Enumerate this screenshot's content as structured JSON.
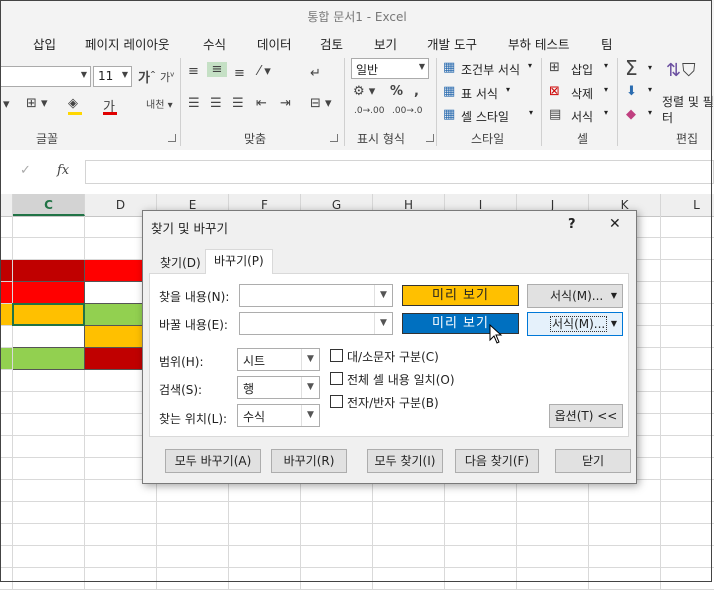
{
  "window": {
    "title": "통합 문서1 - Excel"
  },
  "menu_tabs": [
    "삽입",
    "페이지 레이아웃",
    "수식",
    "데이터",
    "검토",
    "보기",
    "개발 도구",
    "부하 테스트",
    "팀"
  ],
  "ribbon": {
    "font_size": "11",
    "number_format": "일반",
    "conditional_format": "조건부 서식",
    "format_as_table": "표 서식",
    "cell_styles": "셀 스타일",
    "insert": "삽입",
    "delete": "삭제",
    "format": "서식",
    "sort_filter": "정렬 및 필터",
    "groups": {
      "font": "글꼴",
      "alignment": "맞춤",
      "number": "표시 형식",
      "styles": "스타일",
      "cells": "셀",
      "editing": "편집"
    }
  },
  "formula_bar": {
    "fx": "fx",
    "value": ""
  },
  "columns": [
    "C",
    "D",
    "E",
    "F",
    "G",
    "H",
    "I",
    "J",
    "K",
    "L"
  ],
  "selected_column": "C",
  "cell_colors": {
    "dark_red": "#c00000",
    "red": "#ff0000",
    "yellow": "#ffc000",
    "green": "#92d050",
    "white": "#ffffff"
  },
  "dialog": {
    "title": "찾기 및 바꾸기",
    "help": "?",
    "close": "✕",
    "tab_find": "찾기(D)",
    "tab_replace": "바꾸기(P)",
    "find_label": "찾을 내용(N):",
    "replace_label": "바꿀 내용(E):",
    "find_value": "",
    "replace_value": "",
    "preview_find": "미리 보기",
    "preview_replace": "미리 보기",
    "preview_find_color": "#ffc000",
    "preview_replace_color": "#0070c0",
    "format_button": "서식(M)...",
    "within_label": "범위(H):",
    "within_value": "시트",
    "search_label": "검색(S):",
    "search_value": "행",
    "lookin_label": "찾는 위치(L):",
    "lookin_value": "수식",
    "match_case": "대/소문자 구분(C)",
    "match_entire": "전체 셀 내용 일치(O)",
    "match_byte": "전자/반자 구분(B)",
    "options_button": "옵션(T) <<",
    "replace_all": "모두 바꾸기(A)",
    "replace": "바꾸기(R)",
    "find_all": "모두 찾기(I)",
    "find_next": "다음 찾기(F)",
    "close_button": "닫기"
  }
}
